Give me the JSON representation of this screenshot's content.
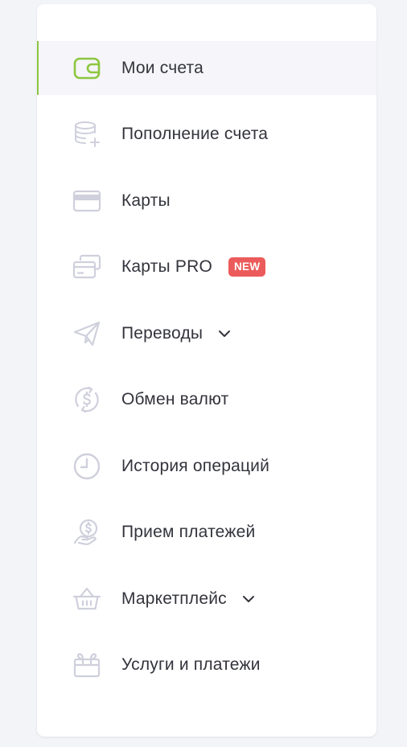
{
  "colors": {
    "accent": "#8dc63f",
    "icon_inactive": "#cfd0dc",
    "text": "#33343c",
    "badge_bg": "#ec5b5b",
    "active_bg": "#f5f5fa",
    "page_bg": "#f3f4f8"
  },
  "menu": {
    "items": [
      {
        "label": "Мои счета",
        "icon": "wallet-icon",
        "active": true
      },
      {
        "label": "Пополнение счета",
        "icon": "database-plus-icon",
        "active": false
      },
      {
        "label": "Карты",
        "icon": "credit-card-icon",
        "active": false
      },
      {
        "label": "Карты PRO",
        "icon": "cards-stack-icon",
        "active": false,
        "badge": "NEW"
      },
      {
        "label": "Переводы",
        "icon": "paper-plane-icon",
        "active": false,
        "has_dropdown": true
      },
      {
        "label": "Обмен валют",
        "icon": "currency-exchange-icon",
        "active": false
      },
      {
        "label": "История операций",
        "icon": "clock-icon",
        "active": false
      },
      {
        "label": "Прием платежей",
        "icon": "hand-coin-icon",
        "active": false
      },
      {
        "label": "Маркетплейс",
        "icon": "basket-icon",
        "active": false,
        "has_dropdown": true
      },
      {
        "label": "Услуги и платежи",
        "icon": "gift-box-icon",
        "active": false
      }
    ]
  }
}
